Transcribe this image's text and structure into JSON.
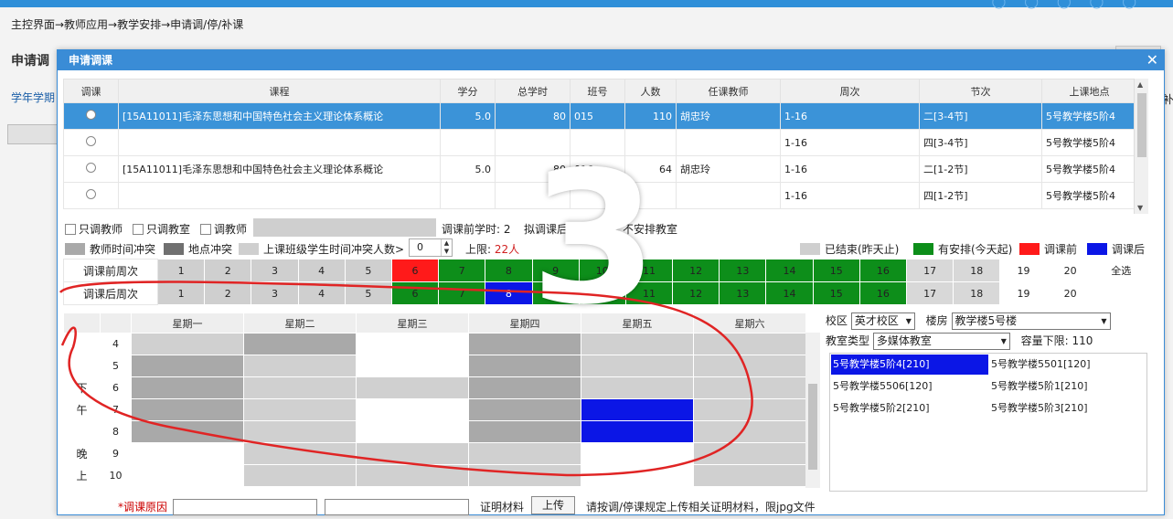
{
  "background": {
    "breadcrumb": "主控界面→教师应用→教学安排→申请调/停/补课",
    "page_title": "申请调",
    "label_left": "学年学期",
    "right_text": "补"
  },
  "dialog": {
    "title": "申请调课",
    "close": "✕"
  },
  "course_table": {
    "headers": [
      "调课",
      "课程",
      "学分",
      "总学时",
      "班号",
      "人数",
      "任课教师",
      "周次",
      "节次",
      "上课地点"
    ],
    "rows": [
      {
        "course": "[15A11011]毛泽东思想和中国特色社会主义理论体系概论",
        "credit": "5.0",
        "hours": "80",
        "class_no": "015",
        "count": "110",
        "teacher": "胡忠玲",
        "weeks": "1-16",
        "period": "二[3-4节]",
        "location": "5号教学楼5阶4"
      },
      {
        "course": "",
        "credit": "",
        "hours": "",
        "class_no": "",
        "count": "",
        "teacher": "",
        "weeks": "1-16",
        "period": "四[3-4节]",
        "location": "5号教学楼5阶4"
      },
      {
        "course": "[15A11011]毛泽东思想和中国特色社会主义理论体系概论",
        "credit": "5.0",
        "hours": "80",
        "class_no": "016",
        "count": "64",
        "teacher": "胡忠玲",
        "weeks": "1-16",
        "period": "二[1-2节]",
        "location": "5号教学楼5阶4"
      },
      {
        "course": "",
        "credit": "",
        "hours": "",
        "class_no": "",
        "count": "",
        "teacher": "",
        "weeks": "1-16",
        "period": "四[1-2节]",
        "location": "5号教学楼5阶4"
      }
    ]
  },
  "options": {
    "only_teacher": "只调教师",
    "only_room": "只调教室",
    "swap_teacher": "调教师",
    "before_hours": "调课前学时: 2",
    "after_hours_label": "拟调课后学时: ",
    "after_hours_value": "2",
    "no_room": "不安排教室"
  },
  "legend": {
    "teacher_conflict": "教师时间冲突",
    "location_conflict": "地点冲突",
    "student_conflict": "上课班级学生时间冲突人数>",
    "spin_value": "0",
    "upper_label": "上限: ",
    "upper_value": "22人",
    "ended": "已结束(昨天止)",
    "arranged": "有安排(今天起)",
    "before": "调课前",
    "after": "调课后",
    "colors": {
      "ended": "#cfcfcf",
      "arranged": "#0d8e1a",
      "before": "#ff1a1a",
      "after": "#0b16e6",
      "teacher": "#a9a9a9",
      "location": "#707070"
    }
  },
  "weeks_before": {
    "label": "调课前周次",
    "weeks": [
      "1",
      "2",
      "3",
      "4",
      "5",
      "6",
      "7",
      "8",
      "9",
      "10",
      "11",
      "12",
      "13",
      "14",
      "15",
      "16",
      "17",
      "18",
      "19",
      "20"
    ],
    "select_all": "全选"
  },
  "weeks_after": {
    "label": "调课后周次",
    "weeks": [
      "1",
      "2",
      "3",
      "4",
      "5",
      "6",
      "7",
      "8",
      "9",
      "10",
      "11",
      "12",
      "13",
      "14",
      "15",
      "16",
      "17",
      "18",
      "19",
      "20"
    ]
  },
  "schedule": {
    "days": [
      "星期一",
      "星期二",
      "星期三",
      "星期四",
      "星期五",
      "星期六"
    ],
    "periods": [
      "4",
      "5",
      "6",
      "7",
      "8",
      "9",
      "10"
    ],
    "afternoon": [
      "下",
      "午"
    ],
    "evening": [
      "晚",
      "上"
    ]
  },
  "side": {
    "campus_label": "校区",
    "campus_value": "英才校区",
    "building_label": "楼房",
    "building_value": "教学楼5号楼",
    "room_type_label": "教室类型",
    "room_type_value": "多媒体教室",
    "capacity_label": "容量下限: ",
    "capacity_value": "110",
    "rooms": [
      "5号教学楼5阶4[210]",
      "5号教学楼5501[120]",
      "5号教学楼5506[120]",
      "5号教学楼5阶1[210]",
      "5号教学楼5阶2[210]",
      "5号教学楼5阶3[210]"
    ]
  },
  "footer": {
    "reason_label": "*调课原因",
    "proof_label": "证明材料",
    "upload": "上传",
    "hint": "请按调/停课规定上传相关证明材料，限jpg文件"
  },
  "overlay_digit": "3"
}
